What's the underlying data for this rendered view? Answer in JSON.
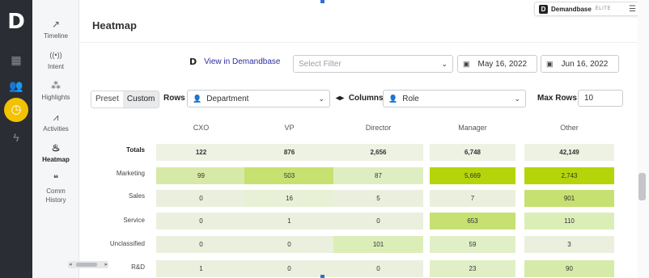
{
  "rail": {
    "logo": "D",
    "icons": [
      "grid-icon",
      "users-icon",
      "timer-icon",
      "bolt-icon"
    ]
  },
  "nav": {
    "items": [
      {
        "label": "Timeline",
        "icon": "↗"
      },
      {
        "label": "Intent",
        "icon": "((•))"
      },
      {
        "label": "Highlights",
        "icon": "⁂"
      },
      {
        "label": "Activities",
        "icon": "⩘"
      },
      {
        "label": "Heatmap",
        "icon": "♨"
      },
      {
        "label": "Comm History",
        "icon": "❝"
      }
    ]
  },
  "header": {
    "title": "Heatmap",
    "brand_name": "Demandbase",
    "brand_tier": "ELITE",
    "brand_logo": "D"
  },
  "toolbar": {
    "view_link": "View in Demandbase",
    "filter_placeholder": "Select Filter",
    "date_start": "May 16, 2022",
    "date_end": "Jun 16, 2022",
    "preset_label": "Preset",
    "custom_label": "Custom",
    "rows_label": "Rows",
    "rows_value": "Department",
    "columns_label": "Columns",
    "columns_value": "Role",
    "max_rows_label": "Max Rows",
    "max_rows_value": "10"
  },
  "heatmap": {
    "columns": [
      "CXO",
      "VP",
      "Director",
      "Manager",
      "Other"
    ],
    "rows": [
      {
        "label": "Totals",
        "values": [
          "122",
          "876",
          "2,656",
          "6,748",
          "42,149"
        ]
      },
      {
        "label": "Marketing",
        "values": [
          "99",
          "503",
          "87",
          "5,669",
          "2,743"
        ]
      },
      {
        "label": "Sales",
        "values": [
          "0",
          "16",
          "5",
          "7",
          "901"
        ]
      },
      {
        "label": "Service",
        "values": [
          "0",
          "1",
          "0",
          "653",
          "110"
        ]
      },
      {
        "label": "Unclassified",
        "values": [
          "0",
          "0",
          "101",
          "59",
          "3"
        ]
      },
      {
        "label": "R&D",
        "values": [
          "1",
          "0",
          "0",
          "23",
          "90"
        ]
      }
    ],
    "colors": [
      [
        "#eef2e3",
        "#eef2e3",
        "#eef2e3",
        "#eef2e3",
        "#eef2e3"
      ],
      [
        "#d7e9a7",
        "#c6e170",
        "#dfeec0",
        "#b5d50a",
        "#b5d50a"
      ],
      [
        "#eaf0dd",
        "#e8f1d6",
        "#eaf0dd",
        "#eaf0dd",
        "#c6e171"
      ],
      [
        "#eaf0dd",
        "#eaf0dd",
        "#eaf0dd",
        "#c6e171",
        "#dceeb7"
      ],
      [
        "#eaf0dd",
        "#eaf0dd",
        "#dceeb7",
        "#e1efc6",
        "#eaf0dd"
      ],
      [
        "#eaf0dd",
        "#eaf0dd",
        "#eaf0dd",
        "#e1efc6",
        "#d6eba9"
      ]
    ]
  }
}
